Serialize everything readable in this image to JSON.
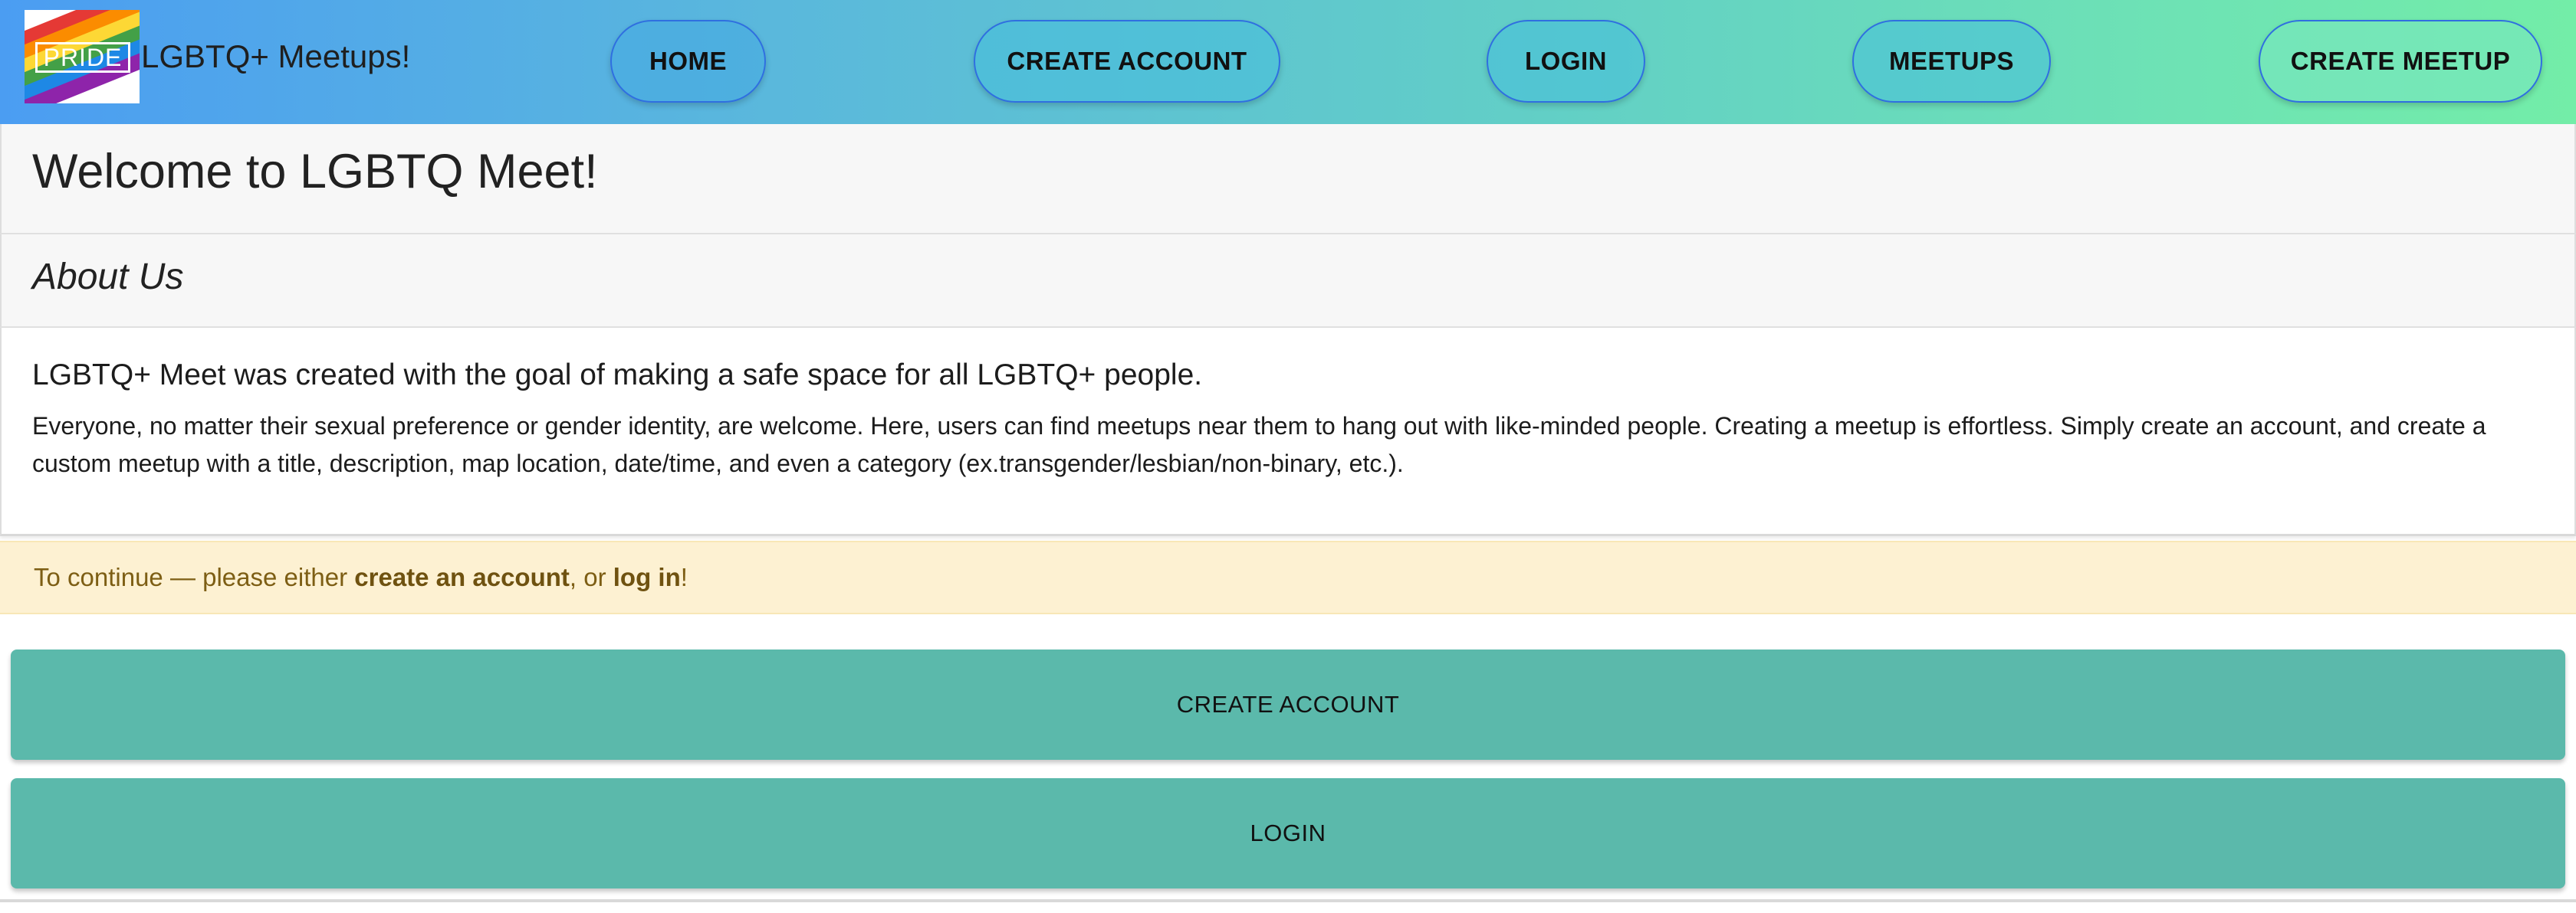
{
  "brand": {
    "logo_text": "PRIDE",
    "title": "LGBTQ+ Meetups!",
    "logo_colors": [
      "#e53935",
      "#fb8c00",
      "#fdd835",
      "#43a047",
      "#1e88e5",
      "#8e24aa"
    ]
  },
  "nav": {
    "home": "HOME",
    "create_account": "CREATE ACCOUNT",
    "login": "LOGIN",
    "meetups": "MEETUPS",
    "create_meetup": "CREATE MEETUP"
  },
  "welcome": {
    "title": "Welcome to LGBTQ Meet!"
  },
  "about": {
    "heading": "About Us",
    "lead": "LGBTQ+ Meet was created with the goal of making a safe space for all LGBTQ+ people.",
    "body": "Everyone, no matter their sexual preference or gender identity, are welcome. Here, users can find meetups near them to hang out with like-minded people. Creating a meetup is effortless. Simply create an account, and create a custom meetup with a title, description, map location, date/time, and even a category (ex.transgender/lesbian/non-binary, etc.)."
  },
  "alert": {
    "prefix": "To continue — please either ",
    "create_link": "create an account",
    "middle": ", or ",
    "login_link": "log in",
    "suffix": "!"
  },
  "actions": {
    "create_account": "CREATE ACCOUNT",
    "login": "LOGIN"
  },
  "colors": {
    "nav_gradient_start": "#4b9df2",
    "nav_gradient_end": "#73eda8",
    "action_button": "#5bb9ab",
    "alert_background": "#fdf1d2",
    "alert_text": "#7d5e14"
  }
}
